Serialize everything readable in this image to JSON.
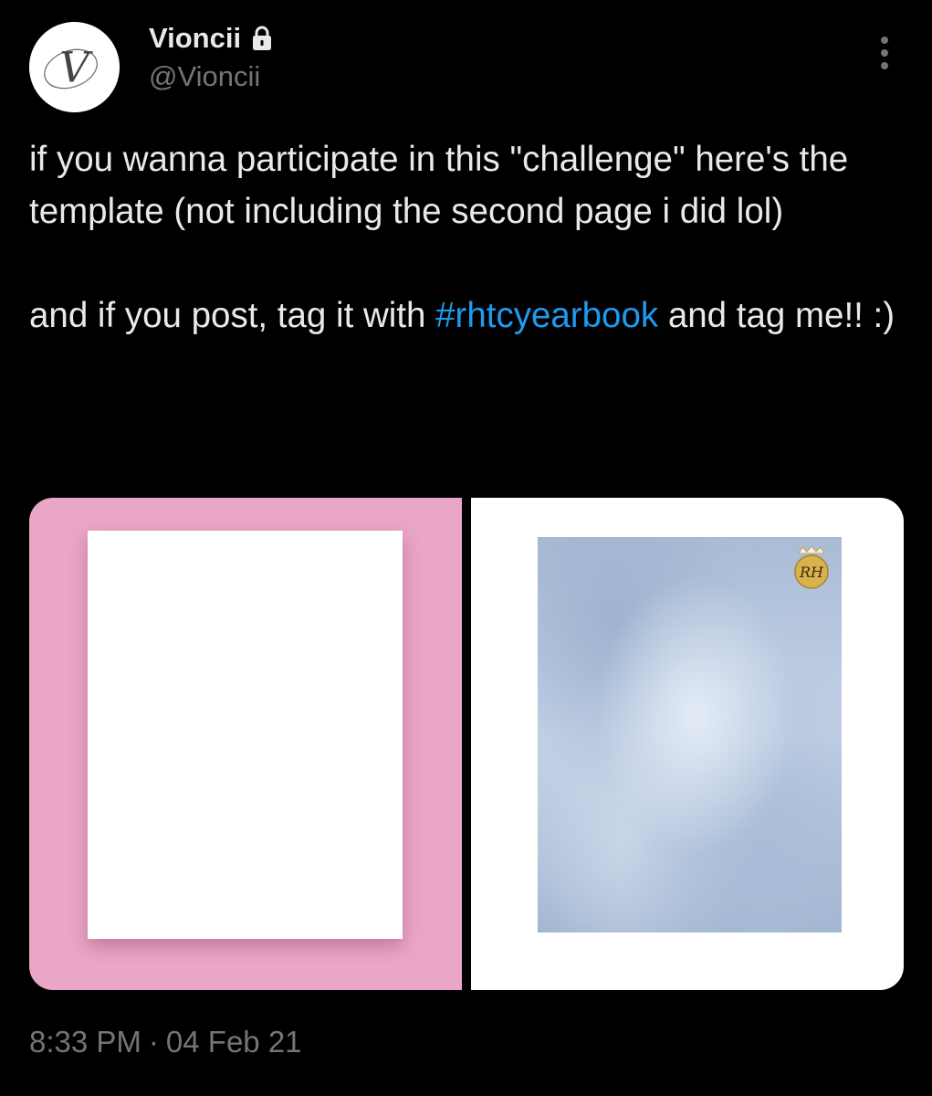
{
  "author": {
    "display_name": "Vioncii",
    "handle": "@Vioncii",
    "avatar_letter": "V",
    "protected_icon": "lock-icon"
  },
  "menu": {
    "icon": "more-vertical-icon"
  },
  "tweet": {
    "text_part1": "if you wanna participate in this \"challenge\" here's the template (not including the second page i did lol)\n\nand if you post, tag it with ",
    "hashtag": "#rhtcyearbook",
    "text_part2": " and tag me!! :)"
  },
  "media": {
    "left_background": "#eaa6c6",
    "right_background": "#ffffff",
    "emblem_text": "RH"
  },
  "meta": {
    "time": "8:33 PM",
    "separator": "·",
    "date": "04 Feb 21"
  },
  "colors": {
    "link": "#1d9bf0",
    "secondary_text": "#71767b",
    "primary_text": "#e7e9ea",
    "background": "#000000"
  }
}
